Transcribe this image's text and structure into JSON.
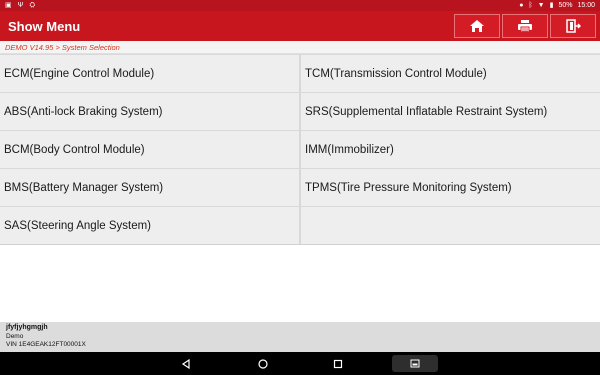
{
  "status_bar": {
    "left_icons": [
      "photo-icon",
      "usb-icon",
      "android-debug-icon"
    ],
    "right_icons": [
      "location-icon",
      "bluetooth-icon",
      "wifi-icon",
      "battery-icon"
    ],
    "battery": "50%",
    "time": "15:00"
  },
  "titlebar": {
    "title": "Show Menu",
    "buttons": [
      "home-icon",
      "print-icon",
      "exit-icon"
    ]
  },
  "breadcrumb": "DEMO V14.95 > System Selection",
  "systems": [
    "ECM(Engine Control Module)",
    "TCM(Transmission Control Module)",
    "ABS(Anti-lock Braking System)",
    "SRS(Supplemental Inflatable Restraint System)",
    "BCM(Body Control Module)",
    "IMM(Immobilizer)",
    "BMS(Battery Manager System)",
    "TPMS(Tire Pressure Monitoring System)",
    "SAS(Steering Angle System)"
  ],
  "vehicle": {
    "name": "jfyfjyhgmgjh",
    "make": "Demo",
    "vin": "VIN 1E4GEAK12FT00001X"
  },
  "navbar": {
    "buttons": [
      "back-icon",
      "home-circle-icon",
      "recents-icon",
      "screenshot-icon"
    ]
  },
  "colors": {
    "titlebar": "#c8161e",
    "statusbar": "#b8141f",
    "breadcrumb_text": "#d4361f",
    "cell_bg": "#eeeeee"
  }
}
